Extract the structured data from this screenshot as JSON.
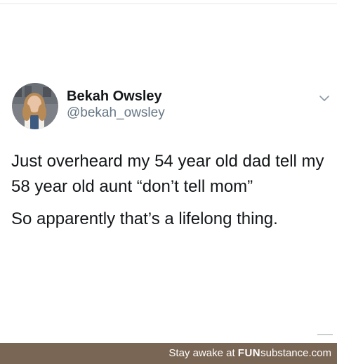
{
  "tweet": {
    "display_name": "Bekah Owsley",
    "handle": "@bekah_owsley",
    "paragraphs": [
      "Just overheard my 54 year old dad tell my 58 year old aunt “don’t tell mom”",
      "So apparently that’s a lifelong thing."
    ],
    "menu_icon": "chevron-down-icon"
  },
  "footer": {
    "prefix": "Stay awake at ",
    "brand_fun": "FUN",
    "brand_rest": "substance.com",
    "bg_color": "#7a6654"
  }
}
